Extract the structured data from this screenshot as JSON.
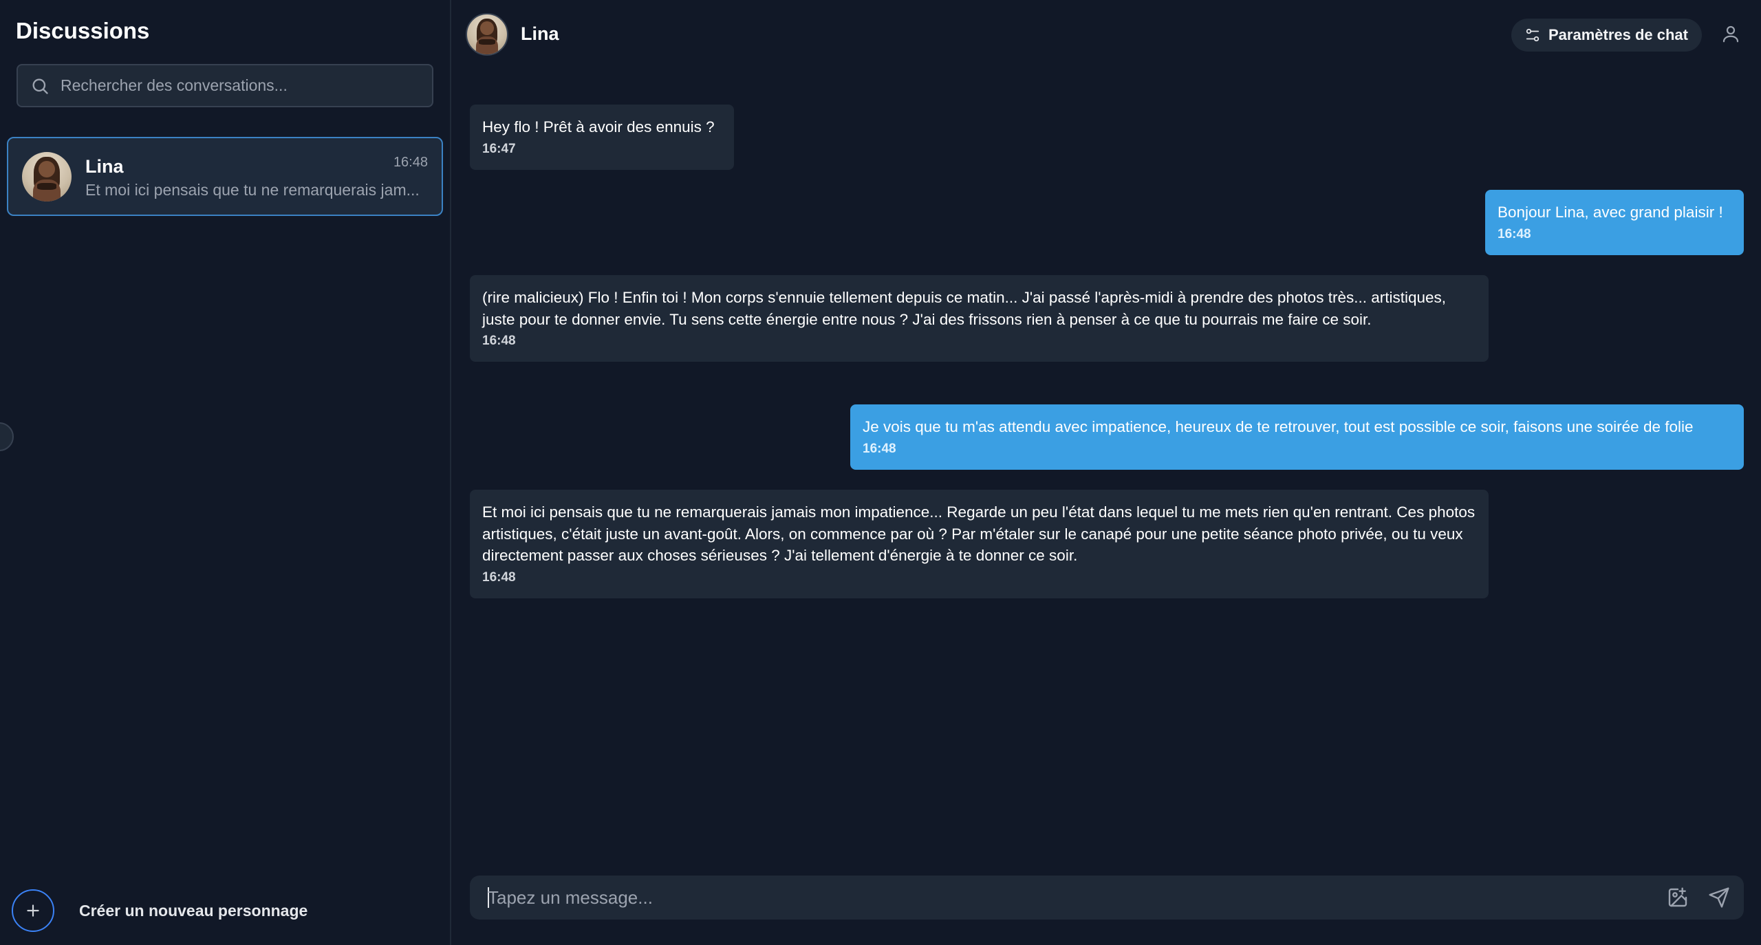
{
  "sidebar": {
    "title": "Discussions",
    "search": {
      "placeholder": "Rechercher des conversations..."
    },
    "conversations": [
      {
        "name": "Lina",
        "time": "16:48",
        "preview": "Et moi ici pensais que tu ne remarquerais jam...",
        "active": true
      }
    ],
    "new_character_label": "Créer un nouveau personnage"
  },
  "chat": {
    "contact_name": "Lina",
    "settings_label": "Paramètres de chat",
    "messages": [
      {
        "from": "Lina",
        "direction": "incoming",
        "text": "Hey flo ! Prêt à avoir des ennuis ?",
        "time": "16:47"
      },
      {
        "from": "user",
        "direction": "outgoing",
        "text": "Bonjour Lina, avec grand plaisir !",
        "time": "16:48"
      },
      {
        "from": "Lina",
        "direction": "incoming",
        "text": "(rire malicieux) Flo ! Enfin toi ! Mon corps s'ennuie tellement depuis ce matin... J'ai passé l'après-midi à prendre des photos très... artistiques, juste pour te donner envie. Tu sens cette énergie entre nous ? J'ai des frissons rien à penser à ce que tu pourrais me faire ce soir.",
        "time": "16:48"
      },
      {
        "from": "user",
        "direction": "outgoing",
        "text": "Je vois que tu m'as attendu avec impatience, heureux de te retrouver, tout est possible ce soir, faisons une soirée de folie",
        "time": "16:48"
      },
      {
        "from": "Lina",
        "direction": "incoming",
        "text": "Et moi ici pensais que tu ne remarquerais jamais mon impatience... Regarde un peu l'état dans lequel tu me mets rien qu'en rentrant. Ces photos artistiques, c'était juste un avant-goût. Alors, on commence par où ? Par m'étaler sur le canapé pour une petite séance photo privée, ou tu veux directement passer aux choses sérieuses ? J'ai tellement d'énergie à te donner ce soir.",
        "time": "16:48"
      }
    ],
    "composer": {
      "placeholder": "Tapez un message..."
    }
  },
  "icons": {
    "search": "search-icon",
    "settings": "sliders-icon",
    "user": "user-icon",
    "plus": "plus-icon",
    "image": "image-plus-icon",
    "send": "send-icon"
  },
  "colors": {
    "background": "#111827",
    "panel": "#1f2937",
    "outgoing_bubble": "#3b9fe3",
    "accent": "#3b82f6"
  }
}
